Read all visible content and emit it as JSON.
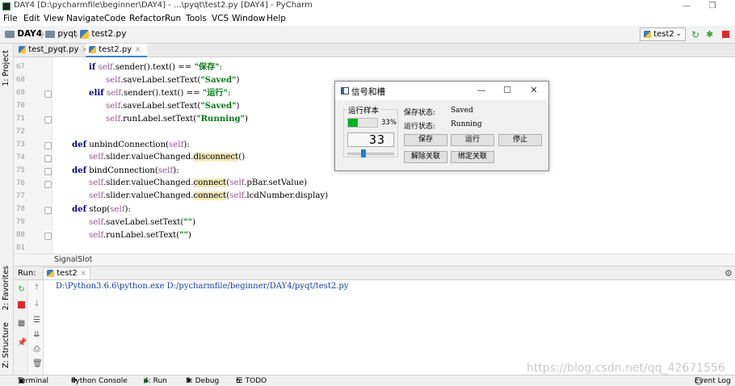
{
  "window": {
    "title": "DAY4 [D:\\pycharmfile\\beginner\\DAY4] - ...\\pyqt\\test2.py [DAY4] - PyCharm",
    "minimize": "—",
    "restore": "❐"
  },
  "menu": [
    "File",
    "Edit",
    "View",
    "Navigate",
    "Code",
    "Refactor",
    "Run",
    "Tools",
    "VCS",
    "Window",
    "Help"
  ],
  "nav": {
    "project": "DAY4",
    "folder": "pyqt",
    "file": "test2.py",
    "run_config": "test2"
  },
  "left_tools": {
    "project": "1: Project",
    "favorites": "2: Favorites",
    "structure": "Z: Structure"
  },
  "tabs": [
    {
      "label": "test_pyqt.py",
      "active": false
    },
    {
      "label": "test2.py",
      "active": true
    }
  ],
  "tab_close": "×",
  "editor": {
    "lines": [
      "67",
      "68",
      "69",
      "70",
      "71",
      "72",
      "73",
      "74",
      "75",
      "76",
      "77",
      "78",
      "79",
      "80",
      "81"
    ],
    "breadcrumb": "SignalSlot"
  },
  "run": {
    "label": "Run:",
    "config": "test2",
    "command": "D:\\Python3.6.6\\python.exe D:/pycharmfile/beginner/DAY4/pyqt/test2.py"
  },
  "statusbar": {
    "terminal": "Terminal",
    "python_console": "Python Console",
    "run": "4: Run",
    "debug": "5: Debug",
    "todo": "6: TODO",
    "event_log": "Event Log"
  },
  "watermark": "https://blog.csdn.net/qq_42671556",
  "dialog": {
    "title": "信号和槽",
    "group_title": "运行样本",
    "progress": 33,
    "progress_text": "33%",
    "lcd_value": "33",
    "slider_value": 33,
    "save_status_label": "保存状态:",
    "save_status_value": "Saved",
    "run_status_label": "运行状态:",
    "run_status_value": "Running",
    "btn_save": "保存",
    "btn_run": "运行",
    "btn_stop": "停止",
    "btn_unbind": "解除关联",
    "btn_bind": "绑定关联"
  },
  "colors": {
    "progress_fill": "#06b025",
    "keyword": "#000080",
    "self": "#94558d",
    "string": "#067d17",
    "highlight": "#f6ebbc",
    "command_text": "#0d3da8"
  }
}
